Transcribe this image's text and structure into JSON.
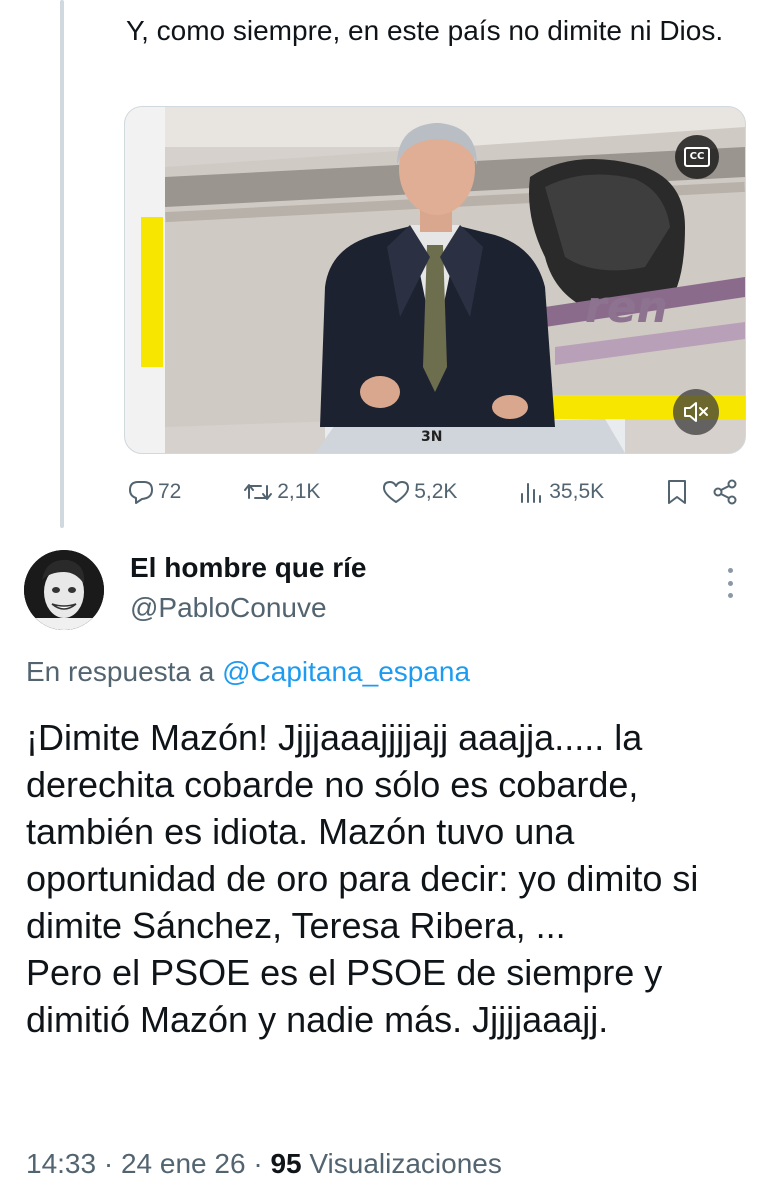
{
  "parent_tweet": {
    "text": "Y, como siempre, en este país no dimite ni Dios.",
    "media": {
      "watermark": "3N",
      "cc_label": "CC",
      "video_background_text": "ren",
      "cc_icon": "closed-captions-icon",
      "mute_icon": "speaker-muted-icon"
    },
    "stats": {
      "replies": "72",
      "reposts": "2,1K",
      "likes": "5,2K",
      "views": "35,5K"
    }
  },
  "reply_tweet": {
    "author_name": "El hombre que ríe",
    "handle": "@PabloConuve",
    "reply_prefix": "En respuesta a",
    "reply_to_handle": "@Capitana_espana",
    "text": "¡Dimite Mazón! Jjjjaaajjjjajj aaajja..... la derechita cobarde no sólo es cobarde, también es idiota. Mazón tuvo una oportunidad de oro para decir: yo dimito si dimite Sánchez, Teresa Ribera, ...\nPero el PSOE es el PSOE de siempre y dimitió Mazón y nadie más. Jjjjjaaajj.",
    "time": "14:33",
    "date": "24 ene 26",
    "separator": "·",
    "view_count": "95",
    "views_label": "Visualizaciones"
  },
  "colors": {
    "text": "#0f1419",
    "secondary": "#536471",
    "link": "#1d9bf0",
    "thread_line": "#cfd9de"
  }
}
